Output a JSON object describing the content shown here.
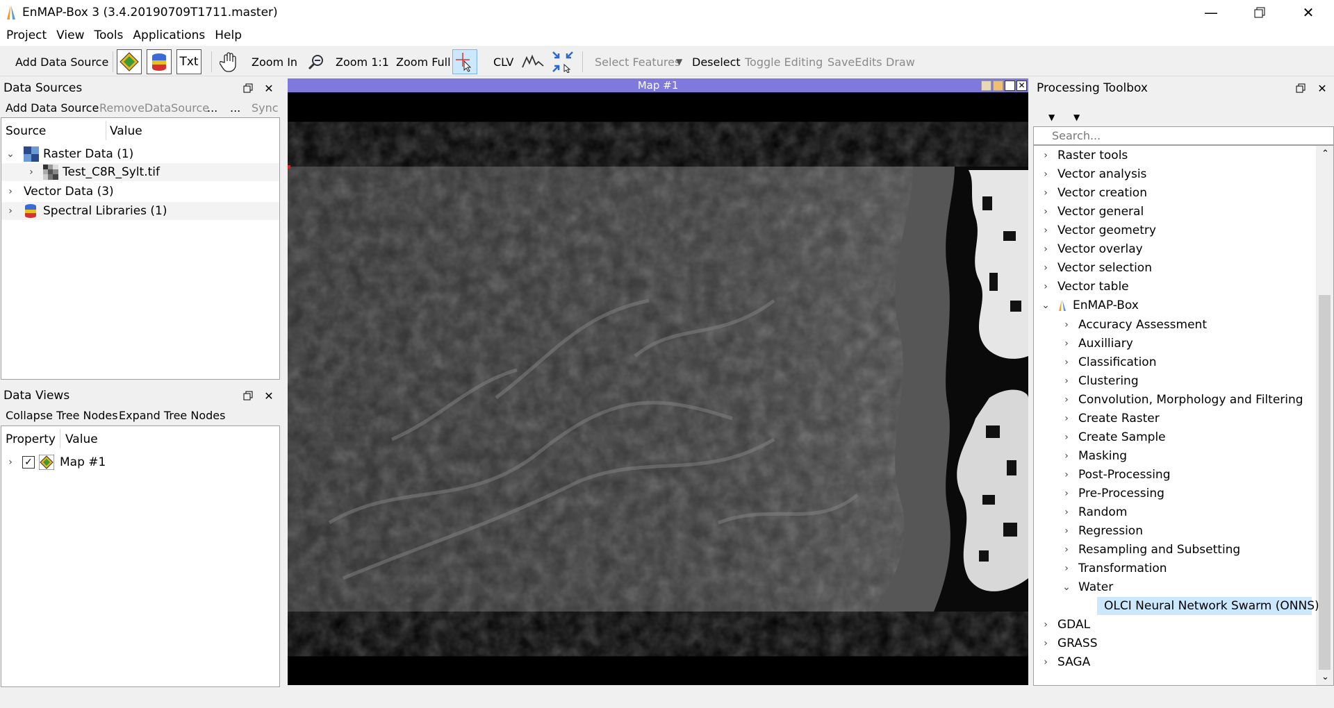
{
  "window": {
    "title": "EnMAP-Box 3 (3.4.20190709T1711.master)"
  },
  "menu": [
    "Project",
    "View",
    "Tools",
    "Applications",
    "Help"
  ],
  "toolbar": {
    "add_data_source": "Add Data Source",
    "txt": "Txt",
    "zoom_in": "Zoom In",
    "zoom_11": "Zoom 1:1",
    "zoom_full": "Zoom Full",
    "clv": "CLV",
    "select_features": "Select Features",
    "deselect": "Deselect",
    "toggle_editing": "Toggle Editing",
    "save_edits": "SaveEdits",
    "draw": "Draw"
  },
  "data_sources": {
    "title": "Data Sources",
    "actions": {
      "add": "Add Data Source",
      "remove": "RemoveDataSource",
      "more1": "...",
      "more2": "...",
      "sync": "Sync"
    },
    "columns": [
      "Source",
      "Value"
    ],
    "items": [
      {
        "label": "Raster Data (1)"
      },
      {
        "label": "Test_C8R_Sylt.tif"
      },
      {
        "label": "Vector Data (3)"
      },
      {
        "label": "Spectral Libraries (1)"
      }
    ]
  },
  "data_views": {
    "title": "Data Views",
    "actions": {
      "collapse": "Collapse Tree Nodes",
      "expand": "Expand Tree Nodes"
    },
    "columns": [
      "Property",
      "Value"
    ],
    "items": [
      {
        "label": "Map #1",
        "checked": true
      }
    ]
  },
  "map": {
    "title": "Map #1"
  },
  "processing": {
    "title": "Processing Toolbox",
    "search_placeholder": "Search...",
    "groups": [
      {
        "label": "Raster tools"
      },
      {
        "label": "Vector analysis"
      },
      {
        "label": "Vector creation"
      },
      {
        "label": "Vector general"
      },
      {
        "label": "Vector geometry"
      },
      {
        "label": "Vector overlay"
      },
      {
        "label": "Vector selection"
      },
      {
        "label": "Vector table"
      },
      {
        "label": "EnMAP-Box"
      },
      {
        "label": "Accuracy Assessment"
      },
      {
        "label": "Auxilliary"
      },
      {
        "label": "Classification"
      },
      {
        "label": "Clustering"
      },
      {
        "label": "Convolution, Morphology and Filtering"
      },
      {
        "label": "Create Raster"
      },
      {
        "label": "Create Sample"
      },
      {
        "label": "Masking"
      },
      {
        "label": "Post-Processing"
      },
      {
        "label": "Pre-Processing"
      },
      {
        "label": "Random"
      },
      {
        "label": "Regression"
      },
      {
        "label": "Resampling and Subsetting"
      },
      {
        "label": "Transformation"
      },
      {
        "label": "Water"
      },
      {
        "label": "OLCI Neural Network Swarm (ONNS)"
      },
      {
        "label": "GDAL"
      },
      {
        "label": "GRASS"
      },
      {
        "label": "SAGA"
      }
    ]
  },
  "colors": {
    "map_title_bar": "#7f78dd",
    "selection": "#cce8ff",
    "accent": "#0078d7"
  }
}
